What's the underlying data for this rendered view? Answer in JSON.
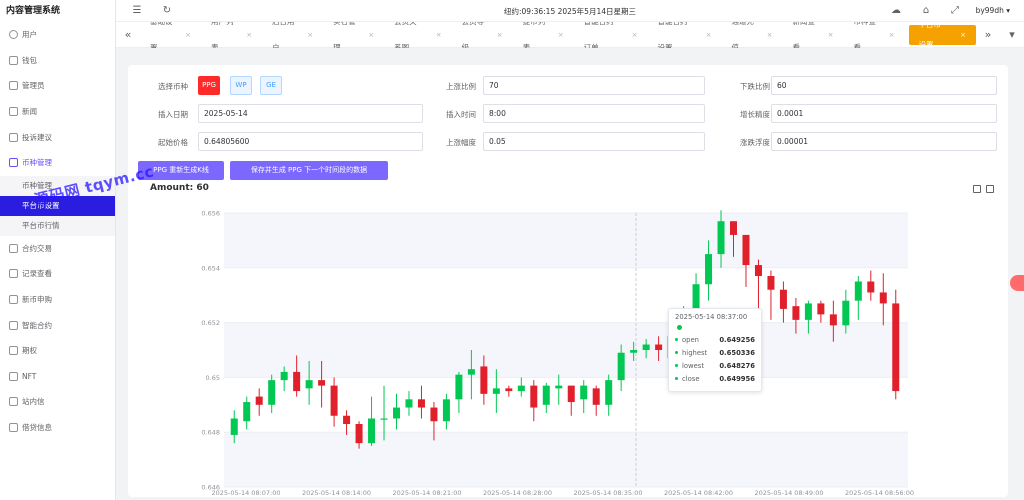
{
  "app_title": "内容管理系统",
  "header": {
    "clock": "纽约:09:36:15 2025年5月14日星期三",
    "user": "by99dh",
    "icons": [
      "menu-fold-icon",
      "refresh-icon",
      "theme-icon",
      "tag-icon",
      "fullscreen-icon"
    ]
  },
  "sidebar": {
    "items": [
      {
        "label": "用户",
        "icon": "user-icon"
      },
      {
        "label": "钱包",
        "icon": "wallet-icon"
      },
      {
        "label": "管理员",
        "icon": "admin-icon"
      },
      {
        "label": "新闻",
        "icon": "news-icon"
      },
      {
        "label": "投诉建议",
        "icon": "feedback-icon"
      },
      {
        "label": "币种管理",
        "icon": "coin-icon"
      },
      {
        "label": "合约交易",
        "icon": "contract-icon"
      },
      {
        "label": "记录查看",
        "icon": "record-icon"
      },
      {
        "label": "新币申购",
        "icon": "subscribe-icon"
      },
      {
        "label": "智能合约",
        "icon": "smart-contract-icon"
      },
      {
        "label": "期权",
        "icon": "option-icon"
      },
      {
        "label": "NFT",
        "icon": "nft-icon"
      },
      {
        "label": "站内信",
        "icon": "message-icon"
      },
      {
        "label": "借贷信息",
        "icon": "loan-icon"
      }
    ],
    "submenu": [
      {
        "label": "币种管理"
      },
      {
        "label": "平台币设置"
      },
      {
        "label": "平台币行情"
      }
    ]
  },
  "tabs": [
    {
      "label": "基础设置"
    },
    {
      "label": "用户列表"
    },
    {
      "label": "后台用户"
    },
    {
      "label": "实名管理"
    },
    {
      "label": "会员关系图"
    },
    {
      "label": "会员等级"
    },
    {
      "label": "提币列表"
    },
    {
      "label": "智能合约订单"
    },
    {
      "label": "智能合约设置"
    },
    {
      "label": "通道充值"
    },
    {
      "label": "新闻查看"
    },
    {
      "label": "币种查看"
    },
    {
      "label": "平台币设置"
    }
  ],
  "form": {
    "coin_label": "选择币种",
    "coins": [
      "PPG",
      "WP",
      "GE"
    ],
    "rise_label": "上涨比例",
    "rise_value": "70",
    "fall_label": "下跌比例",
    "fall_value": "60",
    "date_label": "插入日期",
    "date_value": "2025-05-14",
    "time_label": "插入时间",
    "time_value": "8:00",
    "step_label": "增长精度",
    "step_value": "0.0001",
    "start_label": "起始价格",
    "start_value": "0.64805600",
    "amp_label": "上涨幅度",
    "amp_value": "0.05",
    "fluct_label": "涨跌浮度",
    "fluct_value": "0.00001",
    "btn_generate": "PPG 重新生成K线",
    "btn_save": "保存并生成 PPG 下一个时间段的数据",
    "amount_text": "Amount: 60"
  },
  "watermark": "源码网 tqym.cc",
  "tooltip": {
    "time": "2025-05-14 08:37:00",
    "rows": [
      {
        "k": "open",
        "v": "0.649256"
      },
      {
        "k": "highest",
        "v": "0.650336"
      },
      {
        "k": "lowest",
        "v": "0.648276"
      },
      {
        "k": "close",
        "v": "0.649956"
      }
    ]
  },
  "chart_data": {
    "type": "candlestick",
    "ylim": [
      0.646,
      0.656
    ],
    "yticks": [
      "0.646",
      "0.648",
      "0.65",
      "0.652",
      "0.654",
      "0.656"
    ],
    "xticks": [
      "2025-05-14 08:07:00",
      "2025-05-14 08:14:00",
      "2025-05-14 08:21:00",
      "2025-05-14 08:28:00",
      "2025-05-14 08:35:00",
      "2025-05-14 08:42:00",
      "2025-05-14 08:49:00",
      "2025-05-14 08:56:00"
    ],
    "up_color": "#00c853",
    "down_color": "#e0202b",
    "candles": [
      [
        0.6479,
        0.6485,
        0.6476,
        0.6488
      ],
      [
        0.6484,
        0.6491,
        0.6481,
        0.6493
      ],
      [
        0.6493,
        0.649,
        0.6486,
        0.6496
      ],
      [
        0.649,
        0.6499,
        0.6487,
        0.6501
      ],
      [
        0.6499,
        0.6502,
        0.6495,
        0.6504
      ],
      [
        0.6502,
        0.6495,
        0.6493,
        0.6508
      ],
      [
        0.6496,
        0.6499,
        0.649,
        0.6506
      ],
      [
        0.6499,
        0.6497,
        0.6489,
        0.6506
      ],
      [
        0.6497,
        0.6486,
        0.6482,
        0.65
      ],
      [
        0.6486,
        0.6483,
        0.6479,
        0.6488
      ],
      [
        0.6483,
        0.6476,
        0.6474,
        0.6484
      ],
      [
        0.6476,
        0.6485,
        0.6475,
        0.6493
      ],
      [
        0.6485,
        0.6485,
        0.6477,
        0.6497
      ],
      [
        0.6485,
        0.6489,
        0.6481,
        0.6494
      ],
      [
        0.6489,
        0.6492,
        0.6486,
        0.6495
      ],
      [
        0.6492,
        0.6489,
        0.6485,
        0.6497
      ],
      [
        0.6489,
        0.6484,
        0.6477,
        0.6491
      ],
      [
        0.6484,
        0.6492,
        0.6481,
        0.6494
      ],
      [
        0.6492,
        0.6501,
        0.6487,
        0.6502
      ],
      [
        0.6501,
        0.6503,
        0.6492,
        0.651
      ],
      [
        0.6504,
        0.6494,
        0.649,
        0.6508
      ],
      [
        0.6494,
        0.6496,
        0.6487,
        0.6503
      ],
      [
        0.6496,
        0.6495,
        0.6493,
        0.6497
      ],
      [
        0.6495,
        0.6497,
        0.6493,
        0.65
      ],
      [
        0.6497,
        0.6489,
        0.6484,
        0.6499
      ],
      [
        0.649,
        0.6497,
        0.6487,
        0.6498
      ],
      [
        0.6496,
        0.6497,
        0.649,
        0.6501
      ],
      [
        0.6497,
        0.6491,
        0.6486,
        0.6496
      ],
      [
        0.6492,
        0.6497,
        0.6487,
        0.6499
      ],
      [
        0.6496,
        0.649,
        0.6486,
        0.6497
      ],
      [
        0.649,
        0.6499,
        0.6486,
        0.6501
      ],
      [
        0.6499,
        0.6509,
        0.6495,
        0.6512
      ],
      [
        0.6509,
        0.651,
        0.6506,
        0.6513
      ],
      [
        0.651,
        0.6512,
        0.6507,
        0.6514
      ],
      [
        0.6512,
        0.651,
        0.6506,
        0.6515
      ],
      [
        0.6507,
        0.6515,
        0.6503,
        0.6518
      ],
      [
        0.6515,
        0.6524,
        0.6511,
        0.6526
      ],
      [
        0.6524,
        0.6534,
        0.6518,
        0.6538
      ],
      [
        0.6534,
        0.6545,
        0.6528,
        0.655
      ],
      [
        0.6545,
        0.6557,
        0.654,
        0.6561
      ],
      [
        0.6557,
        0.6552,
        0.6544,
        0.6557
      ],
      [
        0.6552,
        0.6541,
        0.6533,
        0.6552
      ],
      [
        0.6541,
        0.6537,
        0.6525,
        0.6543
      ],
      [
        0.6537,
        0.6532,
        0.6521,
        0.6539
      ],
      [
        0.6532,
        0.6525,
        0.652,
        0.6535
      ],
      [
        0.6526,
        0.6521,
        0.6516,
        0.6529
      ],
      [
        0.6521,
        0.6527,
        0.6516,
        0.6528
      ],
      [
        0.6527,
        0.6523,
        0.652,
        0.6528
      ],
      [
        0.6523,
        0.6519,
        0.6513,
        0.6528
      ],
      [
        0.6519,
        0.6528,
        0.6516,
        0.6532
      ],
      [
        0.6528,
        0.6535,
        0.6521,
        0.6537
      ],
      [
        0.6535,
        0.6531,
        0.6528,
        0.6539
      ],
      [
        0.6531,
        0.6527,
        0.6519,
        0.6538
      ],
      [
        0.6527,
        0.6495,
        0.6492,
        0.6532
      ]
    ]
  }
}
